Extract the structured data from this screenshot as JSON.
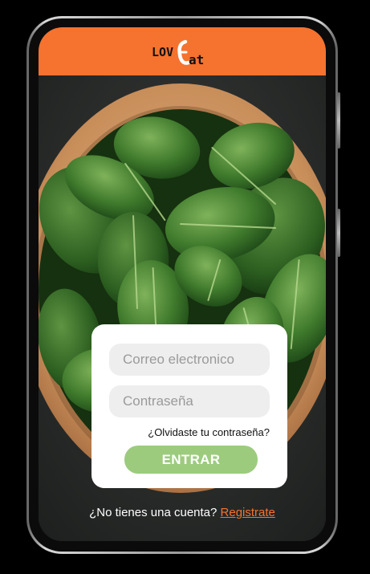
{
  "brand": {
    "logo_left": "LOV",
    "logo_right": "at",
    "header_color": "#f5722f"
  },
  "login": {
    "email_placeholder": "Correo electronico",
    "password_placeholder": "Contraseña",
    "forgot_label": "¿Olvidaste tu contraseña?",
    "submit_label": "ENTRAR",
    "submit_color": "#9ccb7d"
  },
  "signup": {
    "prompt": "¿No tienes una cuenta?",
    "link_label": "Registrate"
  },
  "background": {
    "image": "spinach-bowl"
  }
}
